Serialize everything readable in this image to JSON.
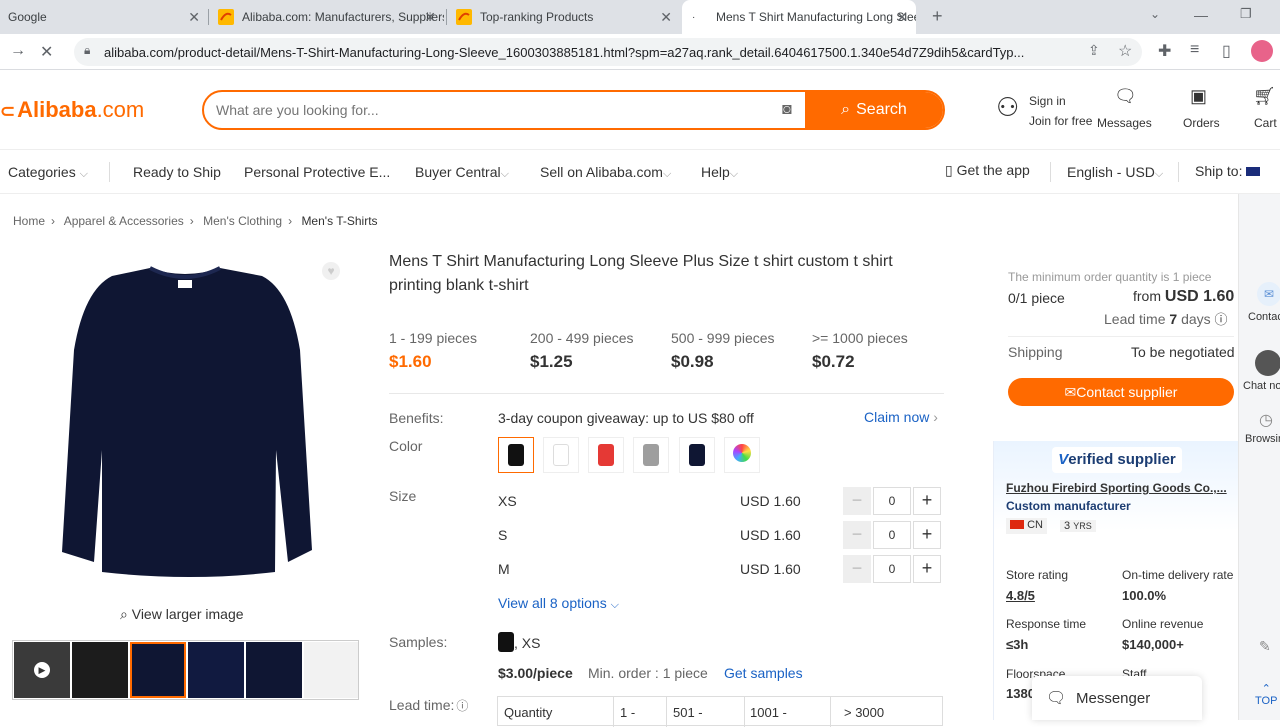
{
  "browser": {
    "tabs": [
      {
        "title": "Google"
      },
      {
        "title": "Alibaba.com: Manufacturers, Suppliers"
      },
      {
        "title": "Top-ranking Products"
      },
      {
        "title": "Mens T Shirt Manufacturing Long Sleeve"
      }
    ],
    "url": "alibaba.com/product-detail/Mens-T-Shirt-Manufacturing-Long-Sleeve_1600303885181.html?spm=a27aq.rank_detail.6404617500.1.340e54d7Z9dih5&cardTyp..."
  },
  "header": {
    "logo": "Alibaba",
    "logo_suffix": ".com",
    "search_placeholder": "What are you looking for...",
    "search_button": "Search",
    "sign_in": "Sign in",
    "join": "Join for free",
    "messages": "Messages",
    "orders": "Orders",
    "cart": "Cart"
  },
  "nav": {
    "categories": "Categories",
    "ready_to_ship": "Ready to Ship",
    "ppe": "Personal Protective E...",
    "buyer_central": "Buyer Central",
    "sell": "Sell on Alibaba.com",
    "help": "Help",
    "get_app": "Get the app",
    "language": "English - USD",
    "ship_to": "Ship to:"
  },
  "breadcrumb": [
    "Home",
    "Apparel & Accessories",
    "Men's Clothing",
    "Men's T-Shirts"
  ],
  "gallery": {
    "view_larger": "View larger image",
    "thumbnail_colors": [
      "#3a3a3a",
      "#1c1c1c",
      "#0f1633",
      "#111a40",
      "#0f1633",
      "#f2f2f2"
    ]
  },
  "product": {
    "title": "Mens T Shirt Manufacturing Long Sleeve Plus Size t shirt custom t shirt printing blank t-shirt",
    "tiers": [
      {
        "qty": "1 - 199 pieces",
        "price": "$1.60"
      },
      {
        "qty": "200 - 499 pieces",
        "price": "$1.25"
      },
      {
        "qty": "500 - 999 pieces",
        "price": "$0.98"
      },
      {
        "qty": ">= 1000 pieces",
        "price": "$0.72"
      }
    ],
    "benefits_label": "Benefits:",
    "benefits_text": "3-day coupon giveaway: up to US $80 off",
    "claim_now": "Claim now",
    "color_label": "Color",
    "color_swatches": [
      "#111111",
      "#ffffff",
      "#e53935",
      "#9e9e9e",
      "#0f1633"
    ],
    "size_label": "Size",
    "sizes": [
      {
        "name": "XS",
        "price": "USD 1.60",
        "qty": "0"
      },
      {
        "name": "S",
        "price": "USD 1.60",
        "qty": "0"
      },
      {
        "name": "M",
        "price": "USD 1.60",
        "qty": "0"
      }
    ],
    "view_all": "View all 8 options",
    "samples_label": "Samples:",
    "sample_size": ", XS",
    "sample_price": "$3.00/piece",
    "sample_min": "Min. order : 1 piece",
    "get_samples": "Get samples",
    "lead_time_label": "Lead time:",
    "lead_table": [
      "Quantity",
      "1 -",
      "501 -",
      "1001 -",
      "> 3000"
    ]
  },
  "order": {
    "min_note": "The minimum order quantity is 1 piece",
    "qty_text": "0/1 piece",
    "from": "from",
    "from_price": "USD 1.60",
    "lead_time": "Lead time",
    "lead_days": "7",
    "days": "days",
    "shipping": "Shipping",
    "shipping_val": "To be negotiated",
    "contact": "Contact supplier"
  },
  "supplier": {
    "verified": "erified supplier",
    "verified_v": "V",
    "name": "Fuzhou Firebird Sporting Goods Co.,...",
    "type": "Custom manufacturer",
    "country": "CN",
    "years": "3",
    "years_unit": "YRS",
    "store_rating_label": "Store rating",
    "store_rating": "4.8/5",
    "ontime_label": "On-time delivery rate",
    "ontime": "100.0%",
    "response_label": "Response time",
    "response": "≤3h",
    "revenue_label": "Online revenue",
    "revenue": "$140,000+",
    "floor_label": "Floorspace",
    "floor": "1380",
    "staff_label": "Staff"
  },
  "side": {
    "contact": "Contact supplier",
    "chat": "Chat now",
    "history": "Browsing History",
    "top": "TOP"
  },
  "messenger": "Messenger"
}
